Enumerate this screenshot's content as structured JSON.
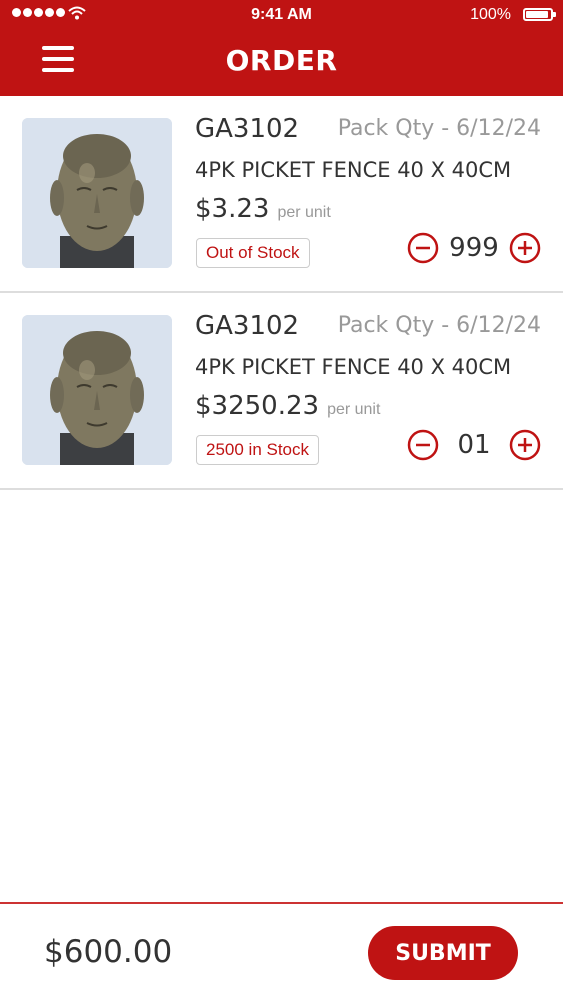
{
  "status_bar": {
    "time": "9:41 AM",
    "battery": "100%"
  },
  "header": {
    "title": "ORDER",
    "menu_icon": "hamburger-menu-icon"
  },
  "colors": {
    "brand": "#bf1313",
    "muted": "#999999",
    "text": "#333333"
  },
  "items": [
    {
      "sku": "GA3102",
      "pack": "Pack Qty - 6/12/24",
      "description": "4PK PICKET FENCE 40 X 40CM",
      "price": "$3.23",
      "unit": "per unit",
      "stock": "Out of Stock",
      "quantity": "999"
    },
    {
      "sku": "GA3102",
      "pack": "Pack Qty - 6/12/24",
      "description": "4PK PICKET FENCE 40 X 40CM",
      "price": "$3250.23",
      "unit": "per unit",
      "stock": "2500 in Stock",
      "quantity": "01"
    }
  ],
  "footer": {
    "total": "$600.00",
    "submit_label": "SUBMIT"
  }
}
